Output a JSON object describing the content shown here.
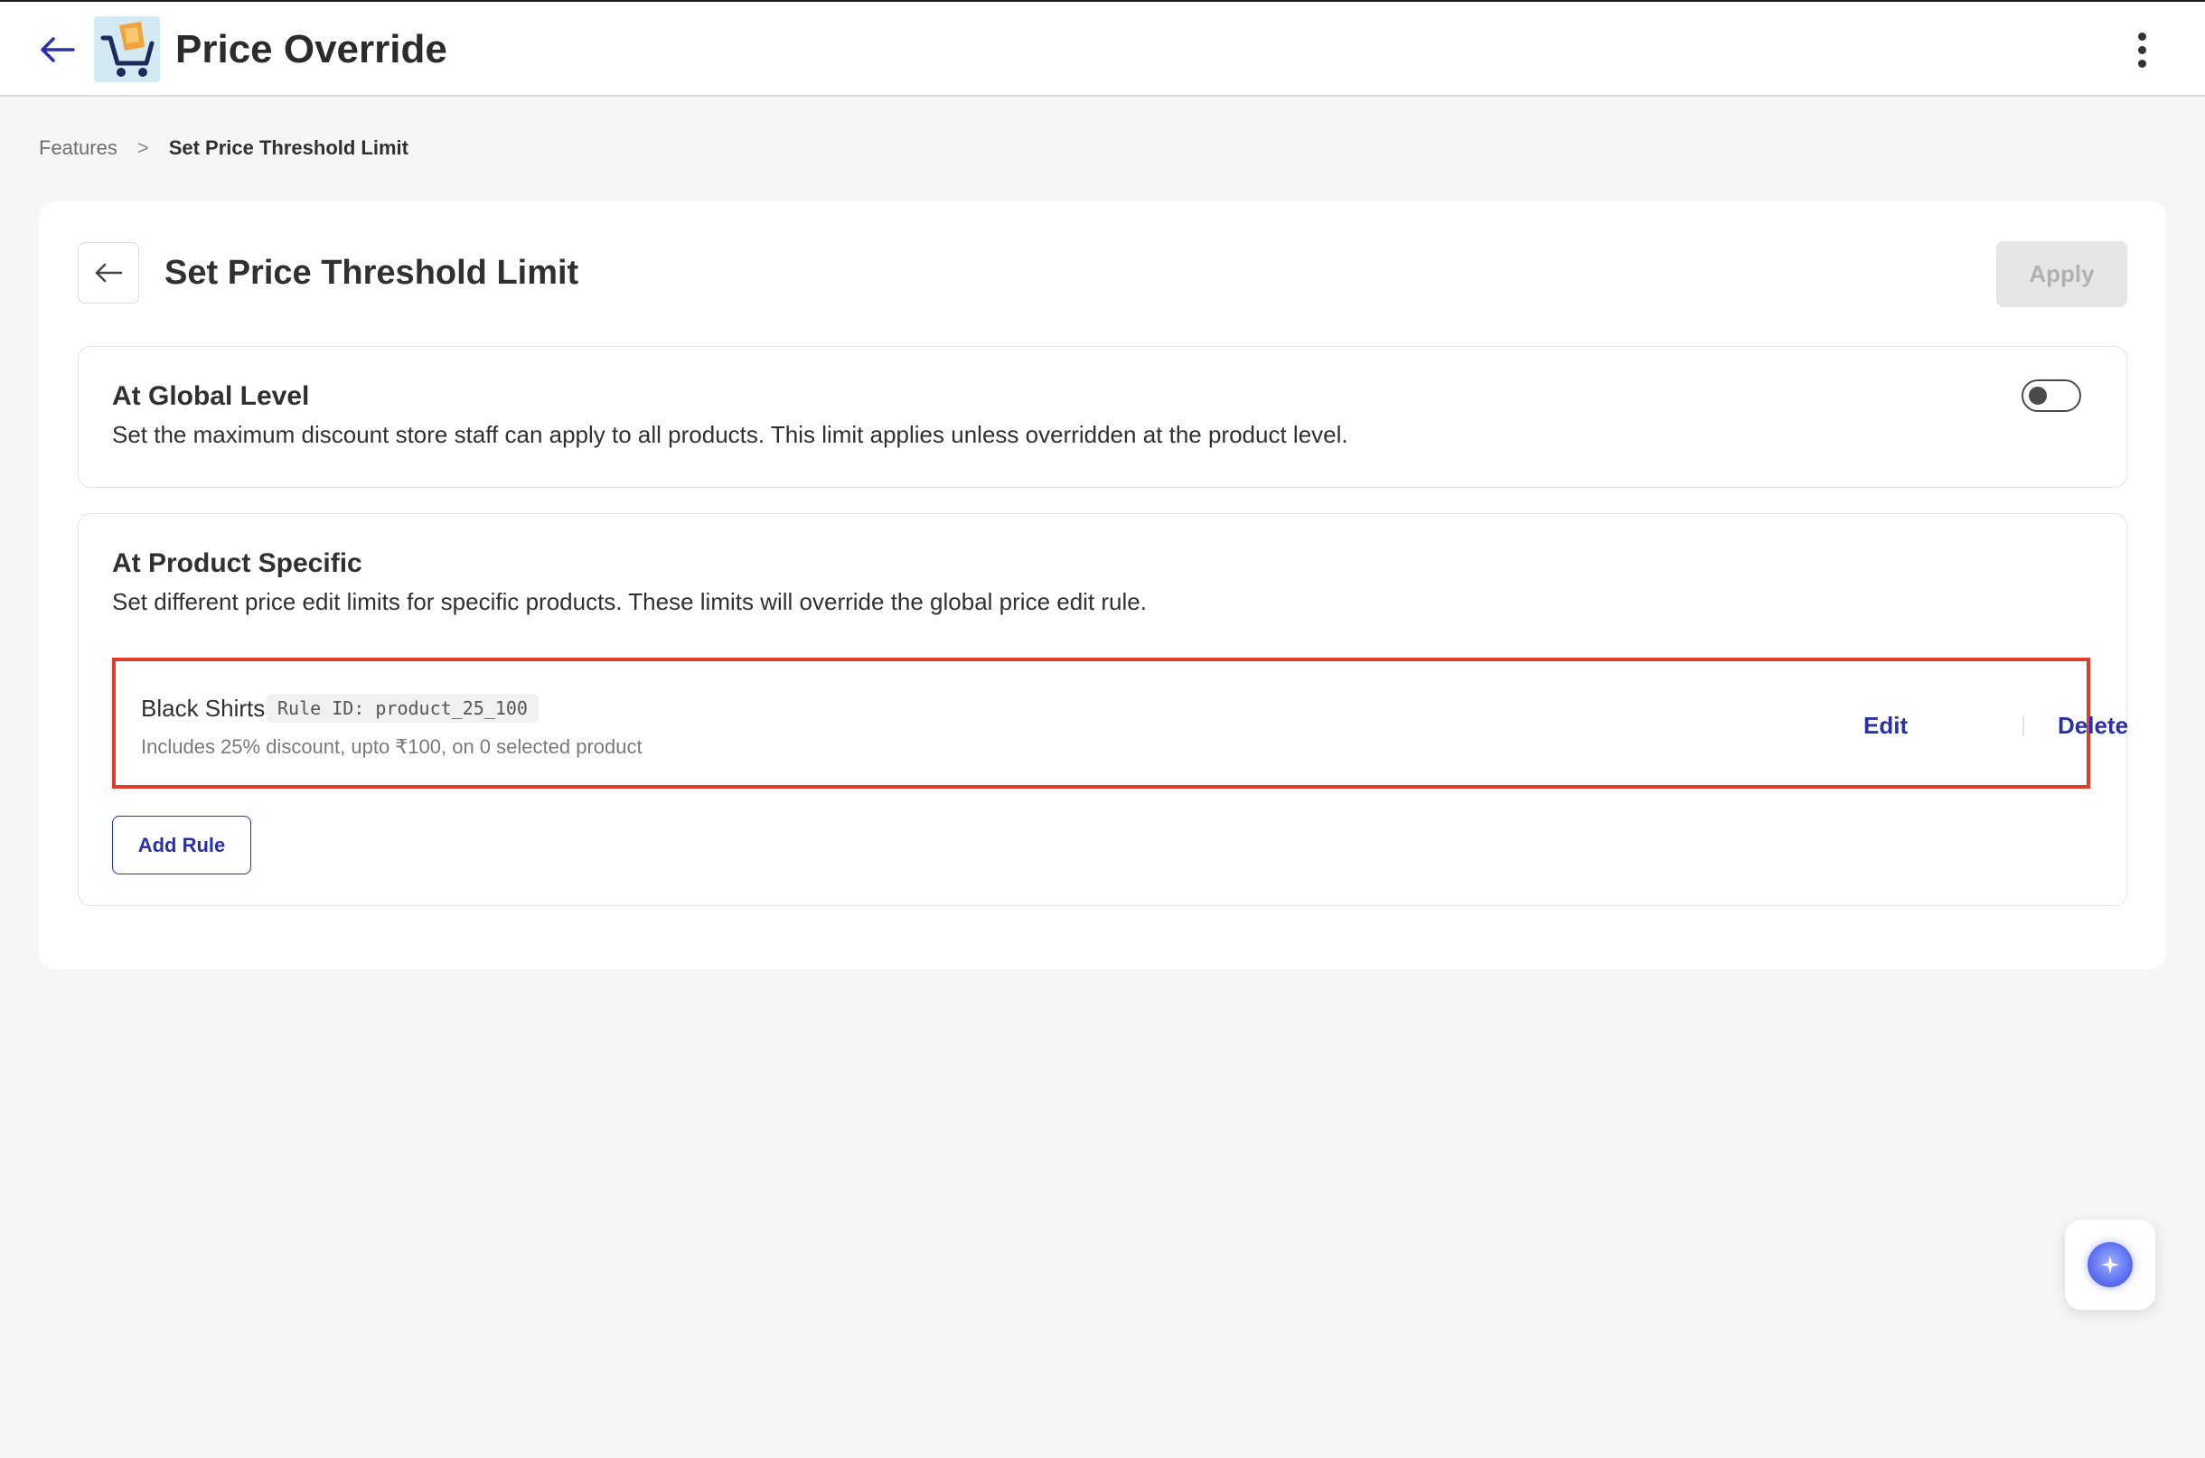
{
  "header": {
    "title": "Price Override"
  },
  "breadcrumb": {
    "items": [
      "Features",
      "Set Price Threshold Limit"
    ],
    "separator": ">"
  },
  "page": {
    "title": "Set Price Threshold Limit",
    "apply_label": "Apply"
  },
  "global_section": {
    "title": "At Global Level",
    "description": "Set the maximum discount store staff can apply to all products. This limit applies unless overridden at the product level.",
    "toggle_on": false
  },
  "product_section": {
    "title": "At Product Specific",
    "description": "Set different price edit limits for specific products. These limits will override the global price edit rule.",
    "rules": [
      {
        "name": "Black Shirts",
        "rule_id": "Rule ID: product_25_100",
        "detail": "Includes 25% discount, upto ₹100, on 0 selected product",
        "edit_label": "Edit",
        "delete_label": "Delete"
      }
    ],
    "add_rule_label": "Add Rule"
  },
  "colors": {
    "accent": "#2a31a8",
    "highlight_border": "#e13b2a",
    "background": "#f6f6f6"
  }
}
